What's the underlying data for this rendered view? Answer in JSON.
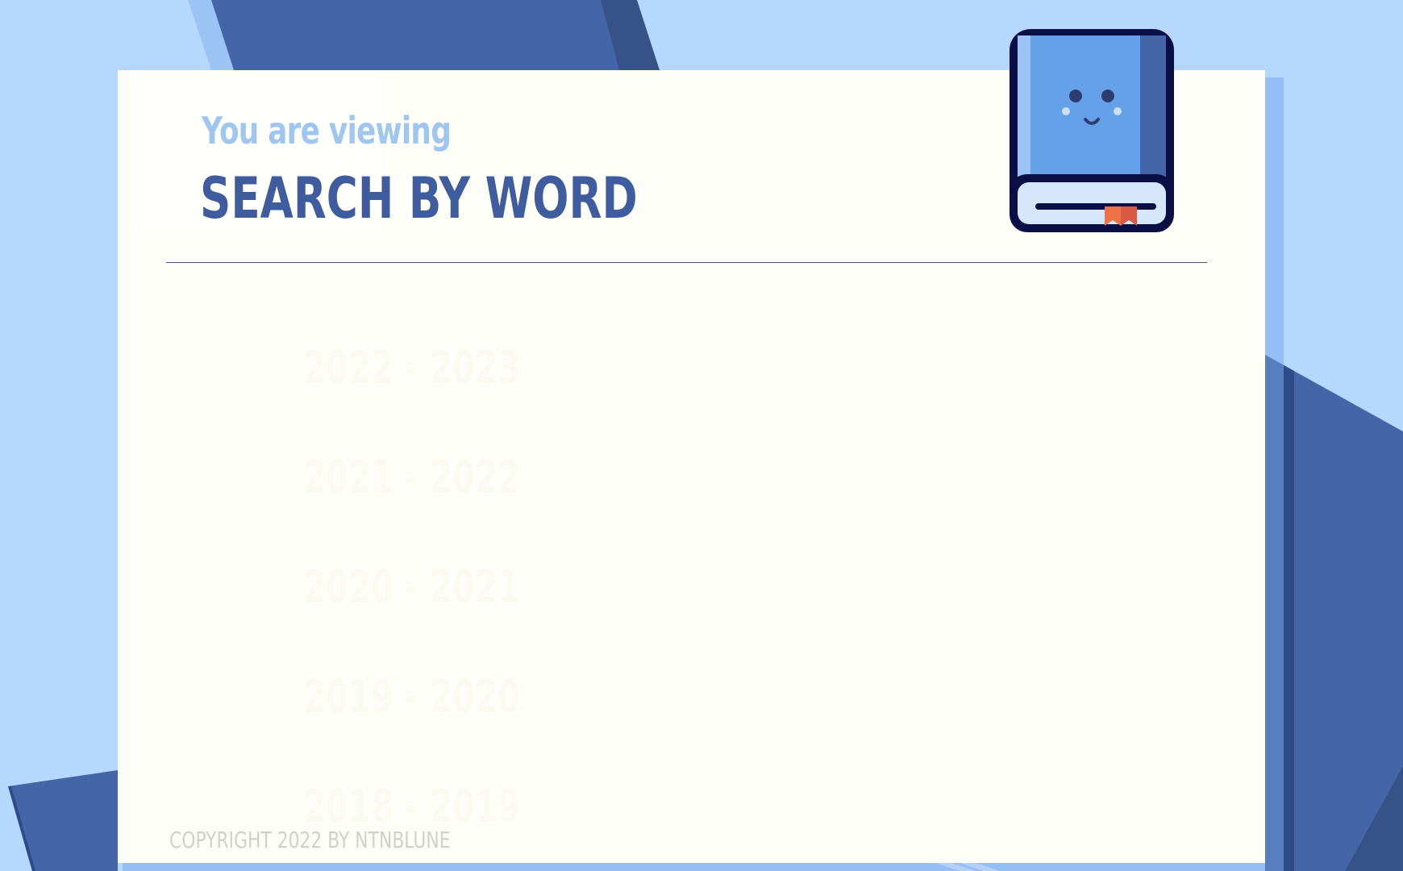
{
  "header": {
    "subtitle": "You are viewing",
    "title": "SEARCH BY WORD"
  },
  "years": [
    {
      "label": "2022 - 2023"
    },
    {
      "label": "2021 - 2022"
    },
    {
      "label": "2020 - 2021"
    },
    {
      "label": "2019 - 2020"
    },
    {
      "label": "2018 - 2019"
    }
  ],
  "footer": {
    "copyright": "COPYRIGHT 2022 BY NTNBLUNE"
  },
  "icons": {
    "mascot": "book-mascot-icon"
  },
  "colors": {
    "background": "#b6d8ff",
    "accent_dark": "#4466a8",
    "card": "#fefef8",
    "title": "#3f5c9e",
    "subtitle": "#9ec6ef",
    "bookmark": "#ee7348"
  }
}
